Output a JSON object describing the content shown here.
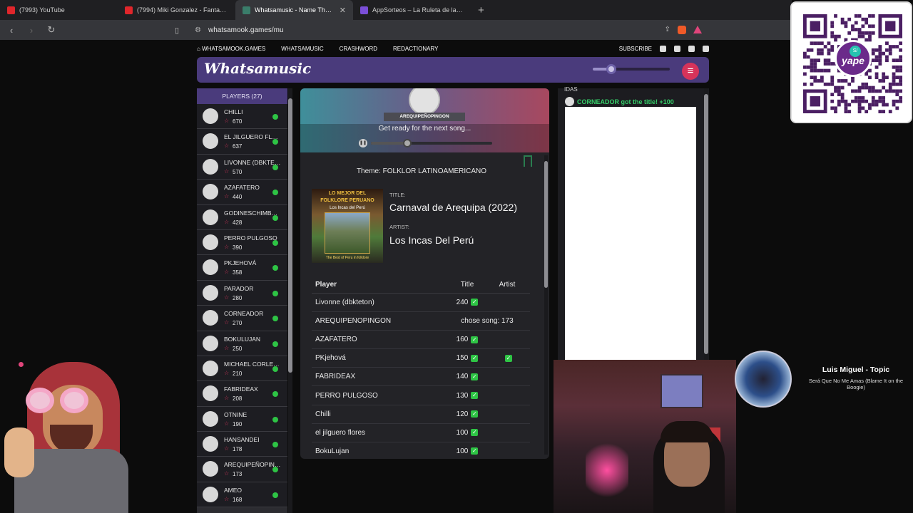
{
  "browser": {
    "tabs": [
      {
        "label": "(7993) YouTube",
        "color": "#e0262b",
        "active": false
      },
      {
        "label": "(7994) Miki Gonzalez - Fantasia De T",
        "color": "#e0262b",
        "active": false
      },
      {
        "label": "Whatsamusic - Name That Tune",
        "color": "#3a7d6a",
        "active": true
      },
      {
        "label": "AppSorteos – La Ruleta de la Suerte",
        "color": "#7a4ed8",
        "active": false
      }
    ],
    "url": "whatsamook.games/mu"
  },
  "site": {
    "nav": [
      "WHATSAMOOK.GAMES",
      "WHATSAMUSIC",
      "CRASHWORD",
      "REDACTIONARY"
    ],
    "subscribe": "SUBSCRIBE",
    "logo": "Whatsamusic",
    "volume": 0.24
  },
  "players": {
    "header": "PLAYERS (27)",
    "list": [
      {
        "name": "CHILLI",
        "score": "670"
      },
      {
        "name": "EL JILGUERO FLO...",
        "score": "637"
      },
      {
        "name": "LIVONNE (DBKTET...",
        "score": "570"
      },
      {
        "name": "AZAFATERO",
        "score": "440"
      },
      {
        "name": "GODINESCHIMBOT...",
        "score": "428"
      },
      {
        "name": "PERRO PULGOSO",
        "score": "390"
      },
      {
        "name": "PKJEHOVÁ",
        "score": "358"
      },
      {
        "name": "PARADOR",
        "score": "280"
      },
      {
        "name": "CORNEADOR",
        "score": "270"
      },
      {
        "name": "BOKULUJAN",
        "score": "250"
      },
      {
        "name": "MICHAEL CORLEO...",
        "score": "210"
      },
      {
        "name": "FABRIDEAX",
        "score": "208"
      },
      {
        "name": "OTNINE",
        "score": "190"
      },
      {
        "name": "HANSANDEI",
        "score": "178"
      },
      {
        "name": "AREQUIPEÑOPING...",
        "score": "173"
      },
      {
        "name": "AMEO",
        "score": "168"
      }
    ]
  },
  "round": {
    "chooser": "AREQUIPEÑOPINGON",
    "status": "Get ready for the next song...",
    "progress": 0.3,
    "theme": "Theme: FOLKLOR LATINOAMERICANO",
    "title_label": "TITLE:",
    "title": "Carnaval de Arequipa (2022)",
    "artist_label": "ARTIST:",
    "artist": "Los Incas Del Perú",
    "cover": {
      "line1": "LO MEJOR DEL",
      "line2": "FOLKLORE PERUANO",
      "line3": "Los Incas del Perú",
      "line4": "The Best of Peru in folklore"
    }
  },
  "results": {
    "headers": {
      "player": "Player",
      "title": "Title",
      "artist": "Artist"
    },
    "rows": [
      {
        "player": "Livonne (dbkteton)",
        "title": "240",
        "title_ok": true,
        "artist_ok": false
      },
      {
        "player": "AREQUIPEÑOPINGON",
        "chosen": "chose song: 173"
      },
      {
        "player": "AZAFATERO",
        "title": "160",
        "title_ok": true,
        "artist_ok": false
      },
      {
        "player": "PKjehová",
        "title": "150",
        "title_ok": true,
        "artist_ok": true
      },
      {
        "player": "FABRIDEAX",
        "title": "140",
        "title_ok": true,
        "artist_ok": false
      },
      {
        "player": "PERRO PULGOSO",
        "title": "130",
        "title_ok": true,
        "artist_ok": false
      },
      {
        "player": "Chilli",
        "title": "120",
        "title_ok": true,
        "artist_ok": false
      },
      {
        "player": "el jilguero flores",
        "title": "100",
        "title_ok": true,
        "artist_ok": false
      },
      {
        "player": "BokuLujan",
        "title": "100",
        "title_ok": true,
        "artist_ok": false
      }
    ]
  },
  "chat": {
    "header": "IDAS",
    "message": "CORNEADOR got the title! +100"
  },
  "qr": {
    "logo": "yape",
    "badge": "S/"
  },
  "now_playing": {
    "artist": "Luis Miguel - Topic",
    "song": "Será Que No Me Amas (Blame It on the Boogie)"
  }
}
